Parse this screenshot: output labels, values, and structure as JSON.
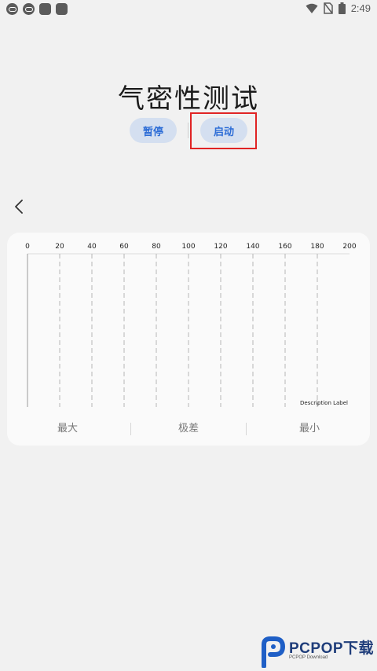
{
  "status_bar": {
    "time": "2:49"
  },
  "page": {
    "title": "气密性测试"
  },
  "controls": {
    "pause_label": "暂停",
    "start_label": "启动"
  },
  "chart_data": {
    "type": "line",
    "x_ticks": [
      "0",
      "20",
      "40",
      "60",
      "80",
      "100",
      "120",
      "140",
      "160",
      "180",
      "200"
    ],
    "xlim": [
      0,
      200
    ],
    "grid": true,
    "description_label": "Description Label",
    "series": []
  },
  "stats": {
    "max_label": "最大",
    "range_label": "极差",
    "min_label": "最小"
  },
  "watermark": {
    "brand": "PCPOP下载",
    "sub": "PCPOP Download"
  }
}
